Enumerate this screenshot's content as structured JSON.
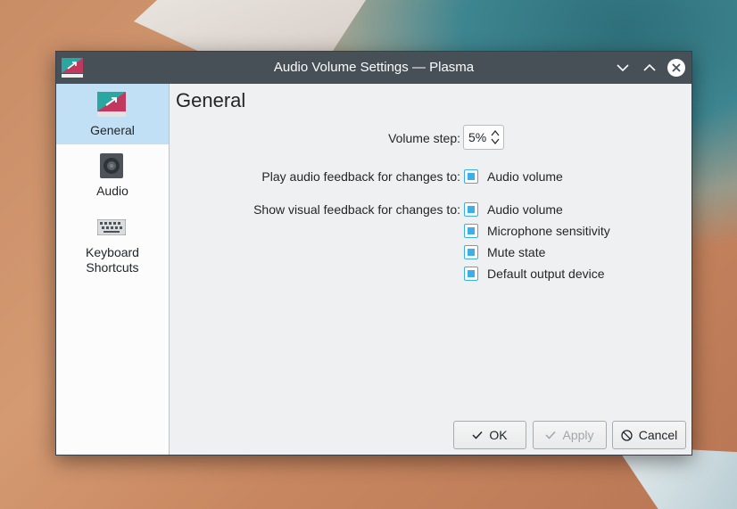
{
  "window": {
    "title": "Audio Volume Settings — Plasma"
  },
  "sidebar": {
    "items": [
      {
        "label": "General",
        "icon": "settings-panel-icon",
        "active": true
      },
      {
        "label": "Audio",
        "icon": "speaker-icon",
        "active": false
      },
      {
        "label_line1": "Keyboard",
        "label_line2": "Shortcuts",
        "icon": "keyboard-icon",
        "active": false
      }
    ]
  },
  "general": {
    "title": "General",
    "volume_step_label": "Volume step:",
    "volume_step_value": "5%",
    "audio_feedback_label": "Play audio feedback for changes to:",
    "audio_feedback_options": [
      {
        "label": "Audio volume",
        "checked": true
      }
    ],
    "visual_feedback_label": "Show visual feedback for changes to:",
    "visual_feedback_options": [
      {
        "label": "Audio volume",
        "checked": true
      },
      {
        "label": "Microphone sensitivity",
        "checked": true
      },
      {
        "label": "Mute state",
        "checked": true
      },
      {
        "label": "Default output device",
        "checked": true
      }
    ]
  },
  "buttons": {
    "ok": "OK",
    "apply": "Apply",
    "cancel": "Cancel"
  },
  "colors": {
    "titlebar": "#475057",
    "accent": "#3daee9",
    "selection": "#c2e0f5"
  }
}
